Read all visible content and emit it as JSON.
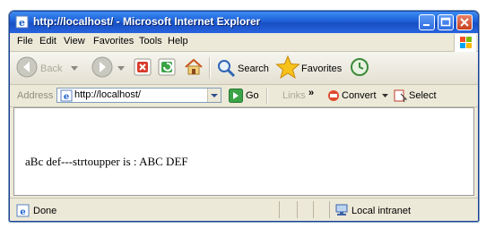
{
  "window": {
    "title": "http://localhost/ - Microsoft Internet Explorer"
  },
  "menu": [
    "File",
    "Edit",
    "View",
    "Favorites",
    "Tools",
    "Help"
  ],
  "toolbar": {
    "back_label": "Back",
    "search_label": "Search",
    "favorites_label": "Favorites"
  },
  "address": {
    "label": "Address",
    "value": "http://localhost/",
    "go_label": "Go",
    "links_label": "Links",
    "convert_label": "Convert",
    "select_label": "Select"
  },
  "page": {
    "text": "aBc def---strtoupper is : ABC DEF"
  },
  "status": {
    "text": "Done",
    "zone": "Local intranet"
  },
  "colors": {
    "titlebar": "#1d5fd6",
    "chrome": "#ece9d8",
    "close": "#c7401e"
  },
  "icons": [
    "ie-icon",
    "minimize-icon",
    "maximize-icon",
    "close-icon",
    "windows-flag-icon",
    "back-icon",
    "forward-icon",
    "stop-icon",
    "refresh-icon",
    "home-icon",
    "search-icon",
    "favorites-star-icon",
    "history-icon",
    "page-icon",
    "go-icon",
    "convert-icon",
    "select-icon",
    "intranet-icon"
  ]
}
